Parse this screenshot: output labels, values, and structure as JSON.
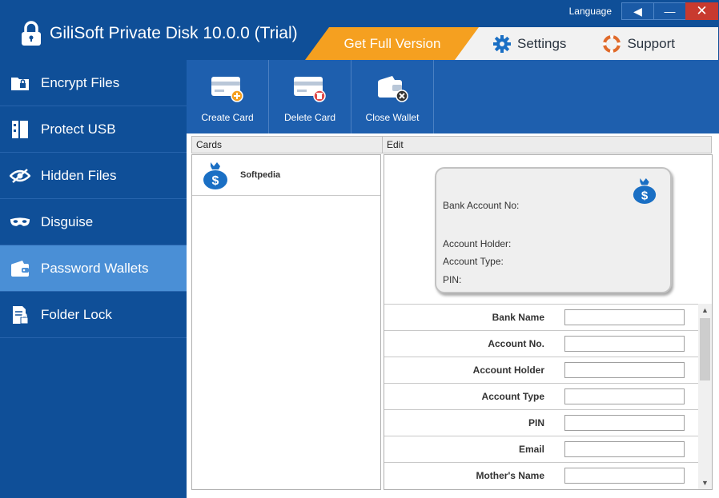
{
  "window": {
    "title": "GiliSoft Private Disk 10.0.0 (Trial)",
    "language_label": "Language",
    "buttons": {
      "back": "◀",
      "minimize": "—",
      "close": "✕"
    }
  },
  "topbar": {
    "get_full": "Get Full Version",
    "settings": "Settings",
    "support": "Support"
  },
  "sidebar": {
    "items": [
      {
        "label": "Encrypt Files",
        "icon": "folder-lock-icon"
      },
      {
        "label": "Protect USB",
        "icon": "usb-icon"
      },
      {
        "label": "Hidden Files",
        "icon": "eye-slash-icon"
      },
      {
        "label": "Disguise",
        "icon": "mask-icon"
      },
      {
        "label": "Password Wallets",
        "icon": "wallet-icon",
        "active": true
      },
      {
        "label": "Folder Lock",
        "icon": "document-lock-icon"
      }
    ]
  },
  "toolbar": {
    "create_card": "Create Card",
    "delete_card": "Delete Card",
    "close_wallet": "Close Wallet"
  },
  "panes": {
    "cards": "Cards",
    "edit": "Edit"
  },
  "cards": [
    {
      "name": "Softpedia",
      "icon": "money-bag-icon"
    }
  ],
  "preview": {
    "bank_account_no": "Bank Account No:",
    "account_holder": "Account Holder:",
    "account_type": "Account Type:",
    "pin": "PIN:"
  },
  "form": {
    "fields": [
      {
        "label": "Bank Name",
        "value": ""
      },
      {
        "label": "Account No.",
        "value": ""
      },
      {
        "label": "Account Holder",
        "value": ""
      },
      {
        "label": "Account Type",
        "value": ""
      },
      {
        "label": "PIN",
        "value": ""
      },
      {
        "label": "Email",
        "value": ""
      },
      {
        "label": "Mother's Name",
        "value": ""
      }
    ]
  },
  "colors": {
    "primary": "#0f4f98",
    "active": "#4a8fd6",
    "accent": "#f5a020",
    "toolbar": "#1e5fae"
  }
}
